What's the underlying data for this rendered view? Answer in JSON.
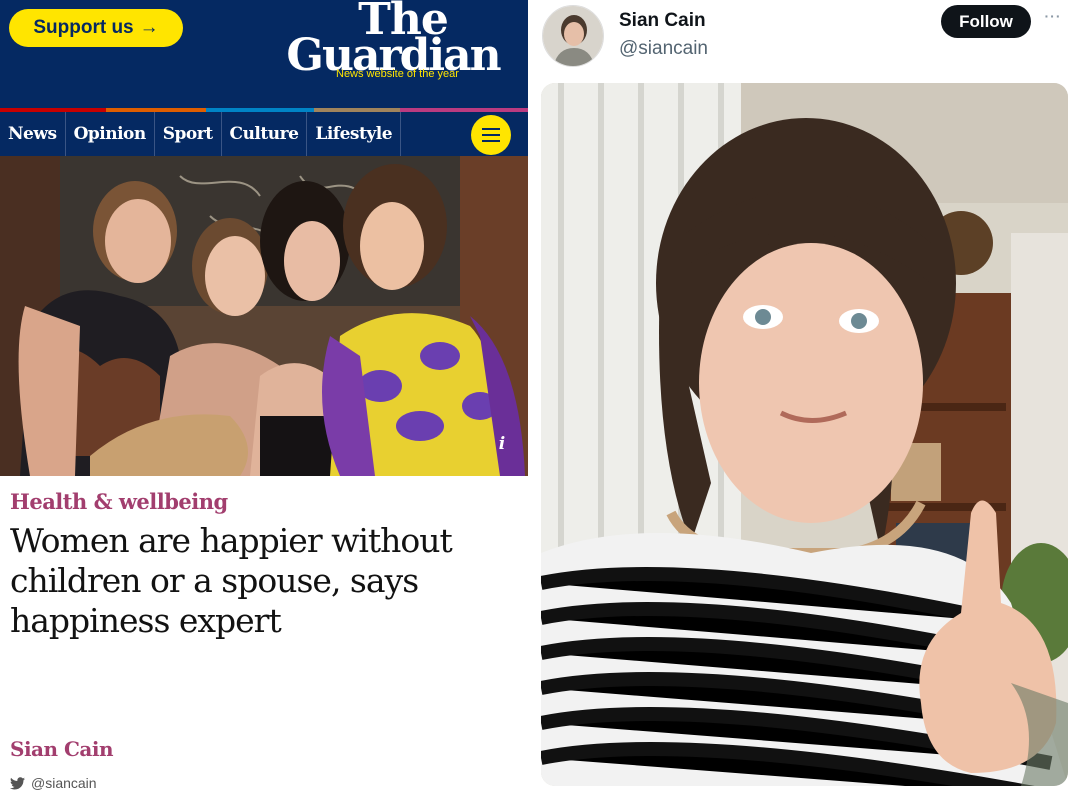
{
  "guardian": {
    "support_label": "Support us",
    "support_arrow": "→",
    "logo_line1": "The",
    "logo_line2": "Guardian",
    "logo_tagline": "News website of the year",
    "nav_items": [
      {
        "label": "News"
      },
      {
        "label": "Opinion"
      },
      {
        "label": "Sport"
      },
      {
        "label": "Culture"
      },
      {
        "label": "Lifestyle"
      }
    ],
    "menu_icon": "hamburger-icon",
    "pillar_colors": [
      "#c70000",
      "#e05e00",
      "#0084c6",
      "#a1845c",
      "#bb3b80"
    ],
    "info_glyph": "i",
    "kicker": "Health & wellbeing",
    "headline": "Women are happier without children or a spouse, says happiness expert",
    "byline": "Sian Cain",
    "twitter_handle": "@siancain",
    "brand_color": "#052962",
    "accent_yellow": "#ffe500",
    "lifestyle_color": "#a23e6e"
  },
  "tweet": {
    "name": "Sian Cain",
    "handle": "@siancain",
    "follow_label": "Follow",
    "more_label": "···"
  }
}
